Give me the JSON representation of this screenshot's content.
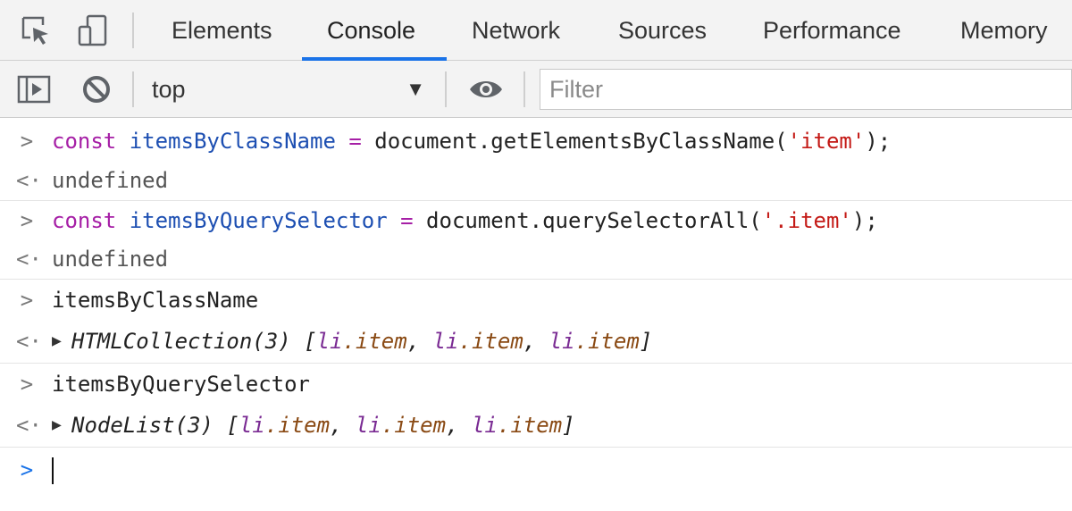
{
  "devtools": {
    "tabs": [
      "Elements",
      "Console",
      "Network",
      "Sources",
      "Performance",
      "Memory"
    ],
    "active_tab": "Console",
    "icons": {
      "inspect": "inspect-element-icon",
      "device": "device-toggle-icon"
    }
  },
  "toolbar": {
    "context": "top",
    "filter_placeholder": "Filter",
    "icons": {
      "sidebar": "sidebar-toggle-icon",
      "clear": "clear-console-icon",
      "eye": "live-expression-eye-icon",
      "dropdown": "dropdown-arrow-icon"
    }
  },
  "console": {
    "input_glyph": ">",
    "output_glyph": "<·",
    "prompt_glyph": ">",
    "expand_glyph": "▶",
    "entries": [
      {
        "input": {
          "kw": "const",
          "name": "itemsByClassName",
          "op": "=",
          "call": "document.getElementsByClassName(",
          "str": "'item'",
          "end": ");"
        },
        "output": "undefined"
      },
      {
        "input": {
          "kw": "const",
          "name": "itemsByQuerySelector",
          "op": "=",
          "call": "document.querySelectorAll(",
          "str": "'.item'",
          "end": ");"
        },
        "output": "undefined"
      },
      {
        "input_plain": "itemsByClassName",
        "result": {
          "type": "HTMLCollection(3)",
          "open": "[",
          "items": [
            {
              "tag": "li",
              "cls": ".item"
            },
            {
              "tag": "li",
              "cls": ".item"
            },
            {
              "tag": "li",
              "cls": ".item"
            }
          ],
          "sep": ",",
          "close": "]"
        }
      },
      {
        "input_plain": "itemsByQuerySelector",
        "result": {
          "type": "NodeList(3)",
          "open": "[",
          "items": [
            {
              "tag": "li",
              "cls": ".item"
            },
            {
              "tag": "li",
              "cls": ".item"
            },
            {
              "tag": "li",
              "cls": ".item"
            }
          ],
          "sep": ",",
          "close": "]"
        }
      }
    ]
  },
  "colors": {
    "accent": "#1a73e8",
    "keyword": "#a61fa6",
    "variable": "#1d4fb2",
    "string": "#c41a16"
  }
}
